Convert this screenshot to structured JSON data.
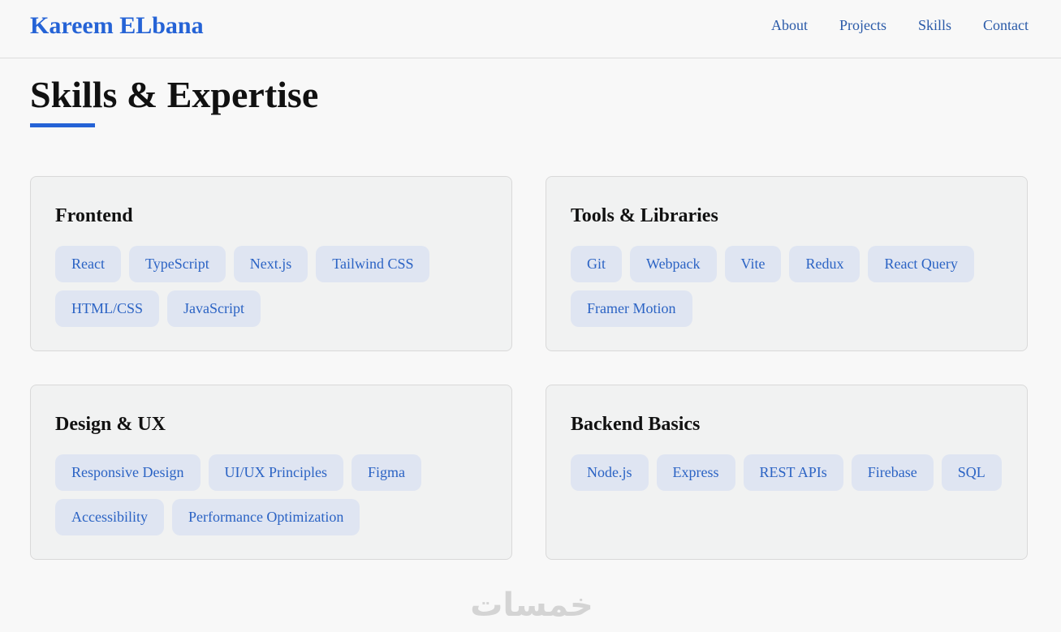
{
  "nav": {
    "brand": "Kareem ELbana",
    "links": [
      "About",
      "Projects",
      "Skills",
      "Contact"
    ]
  },
  "page": {
    "title": "Skills & Expertise"
  },
  "skills": [
    {
      "title": "Frontend",
      "tags": [
        "React",
        "TypeScript",
        "Next.js",
        "Tailwind CSS",
        "HTML/CSS",
        "JavaScript"
      ]
    },
    {
      "title": "Tools & Libraries",
      "tags": [
        "Git",
        "Webpack",
        "Vite",
        "Redux",
        "React Query",
        "Framer Motion"
      ]
    },
    {
      "title": "Design & UX",
      "tags": [
        "Responsive Design",
        "UI/UX Principles",
        "Figma",
        "Accessibility",
        "Performance Optimization"
      ]
    },
    {
      "title": "Backend Basics",
      "tags": [
        "Node.js",
        "Express",
        "REST APIs",
        "Firebase",
        "SQL"
      ]
    }
  ],
  "watermark": "خمسات",
  "colors": {
    "accent": "#2563d6",
    "tag_background": "#dfe5f2",
    "tag_text": "#2b63c4",
    "card_background": "#f1f2f2",
    "page_background": "#f8f8f8"
  }
}
